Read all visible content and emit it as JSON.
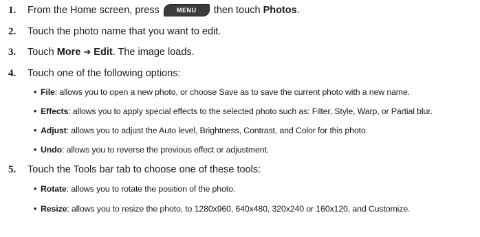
{
  "steps": [
    {
      "num": "1.",
      "pre": "From the Home screen, press",
      "key": "MENU",
      "mid": "then touch",
      "bold": "Photos",
      "post": "."
    },
    {
      "num": "2.",
      "text": "Touch the photo name that you want to edit."
    },
    {
      "num": "3.",
      "pre": "Touch",
      "bold1": "More",
      "arrow": "➔",
      "bold2": "Edit",
      "post": ". The image loads."
    },
    {
      "num": "4.",
      "text": "Touch one of the following options:"
    },
    {
      "num": "5.",
      "text": "Touch the Tools bar tab to choose one of these tools:"
    }
  ],
  "options": [
    {
      "term": "File",
      "desc": ": allows you to open a new photo, or choose Save as to save the current photo with a new name."
    },
    {
      "term": "Effects",
      "desc": ": allows you to apply special effects to the selected photo such as: Filter, Style, Warp, or Partial blur."
    },
    {
      "term": "Adjust",
      "desc": ": allows you to adjust the Auto level, Brightness, Contrast, and Color for this photo."
    },
    {
      "term": "Undo",
      "desc": ": allows you to reverse the previous effect or adjustment."
    }
  ],
  "tools": [
    {
      "term": "Rotate",
      "desc": ": allows you to rotate the position of the photo."
    },
    {
      "term": "Resize",
      "desc": ": allows you to resize the photo, to 1280x960, 640x480, 320x240 or 160x120, and Customize."
    }
  ],
  "bullet_char": "•"
}
